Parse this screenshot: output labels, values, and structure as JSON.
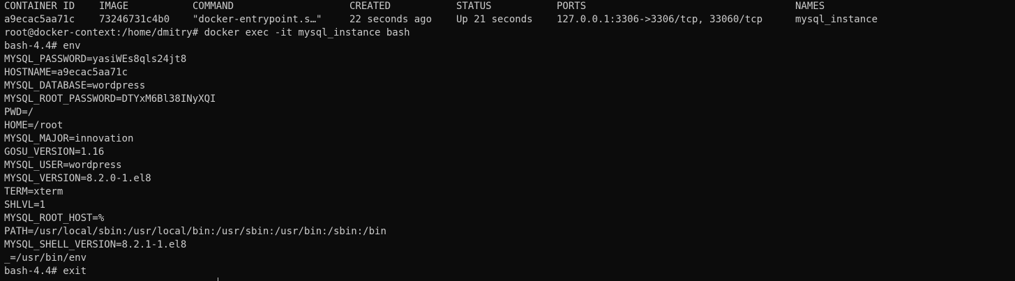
{
  "terminal": {
    "colors": {
      "background": "#0c0c0c",
      "foreground": "#cccccc"
    },
    "table": {
      "headers": [
        "CONTAINER ID",
        "IMAGE",
        "COMMAND",
        "CREATED",
        "STATUS",
        "PORTS",
        "NAMES"
      ],
      "row": [
        "a9ecac5aa71c",
        "73246731c4b0",
        "\"docker-entrypoint.s…\"",
        "22 seconds ago",
        "Up 21 seconds",
        "127.0.0.1:3306->3306/tcp, 33060/tcp",
        "mysql_instance"
      ]
    },
    "lines": [
      "root@docker-context:/home/dmitry# docker exec -it mysql_instance bash",
      "bash-4.4# env",
      "MYSQL_PASSWORD=yasiWEs8qls24jt8",
      "HOSTNAME=a9ecac5aa71c",
      "MYSQL_DATABASE=wordpress",
      "MYSQL_ROOT_PASSWORD=DTYxM6Bl38INyXQI",
      "PWD=/",
      "HOME=/root",
      "MYSQL_MAJOR=innovation",
      "GOSU_VERSION=1.16",
      "MYSQL_USER=wordpress",
      "MYSQL_VERSION=8.2.0-1.el8",
      "TERM=xterm",
      "SHLVL=1",
      "MYSQL_ROOT_HOST=%",
      "PATH=/usr/local/sbin:/usr/local/bin:/usr/sbin:/usr/bin:/sbin:/bin",
      "MYSQL_SHELL_VERSION=8.2.1-1.el8",
      "_=/usr/bin/env",
      "bash-4.4# exit"
    ]
  }
}
